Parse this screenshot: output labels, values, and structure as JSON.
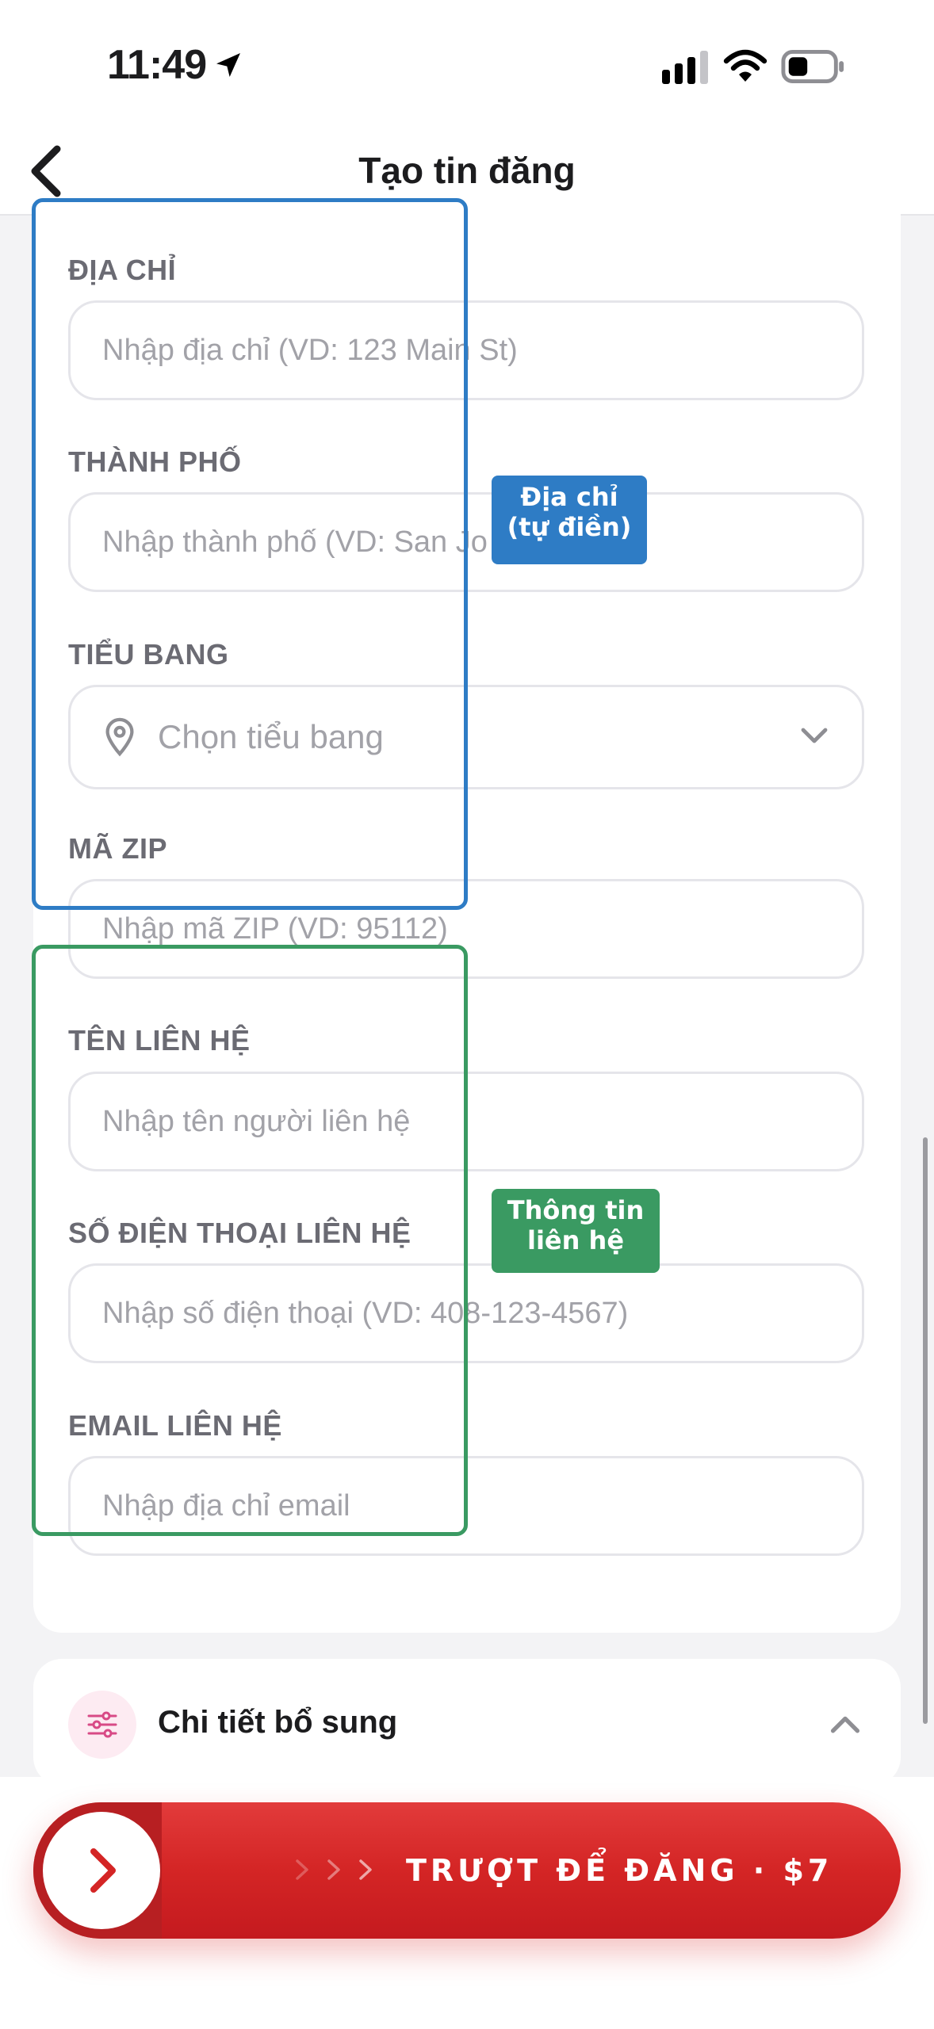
{
  "status_bar": {
    "time": "11:49"
  },
  "nav": {
    "title": "Tạo tin đăng"
  },
  "form": {
    "address": {
      "label": "ĐỊA CHỈ",
      "placeholder": "Nhập địa chỉ (VD: 123 Main St)"
    },
    "city": {
      "label": "THÀNH PHỐ",
      "placeholder": "Nhập thành phố (VD: San Jo"
    },
    "state": {
      "label": "TIỂU BANG",
      "placeholder": "Chọn tiểu bang"
    },
    "zip": {
      "label": "MÃ ZIP",
      "placeholder": "Nhập mã ZIP (VD: 95112)"
    },
    "contact_name": {
      "label": "TÊN LIÊN HỆ",
      "placeholder": "Nhập tên người liên hệ"
    },
    "contact_phone": {
      "label": "SỐ ĐIỆN THOẠI LIÊN HỆ",
      "placeholder": "Nhập số điện thoại (VD: 408-123-4567)"
    },
    "contact_email": {
      "label": "EMAIL LIÊN HỆ",
      "placeholder": "Nhập địa chỉ email"
    }
  },
  "annotations": {
    "address_group": {
      "text": "Địa chỉ\n(tự điền)",
      "color": "#2e7cc5"
    },
    "contact_group": {
      "text": "Thông tin\nliên hệ",
      "color": "#3a9a62"
    }
  },
  "additional": {
    "title": "Chi tiết bổ sung"
  },
  "slider": {
    "label": "TRƯỢT ĐỂ ĐĂNG · $7"
  },
  "colors": {
    "accent_red": "#d42525",
    "annot_blue": "#2e7cc5",
    "annot_green": "#3a9a62"
  }
}
